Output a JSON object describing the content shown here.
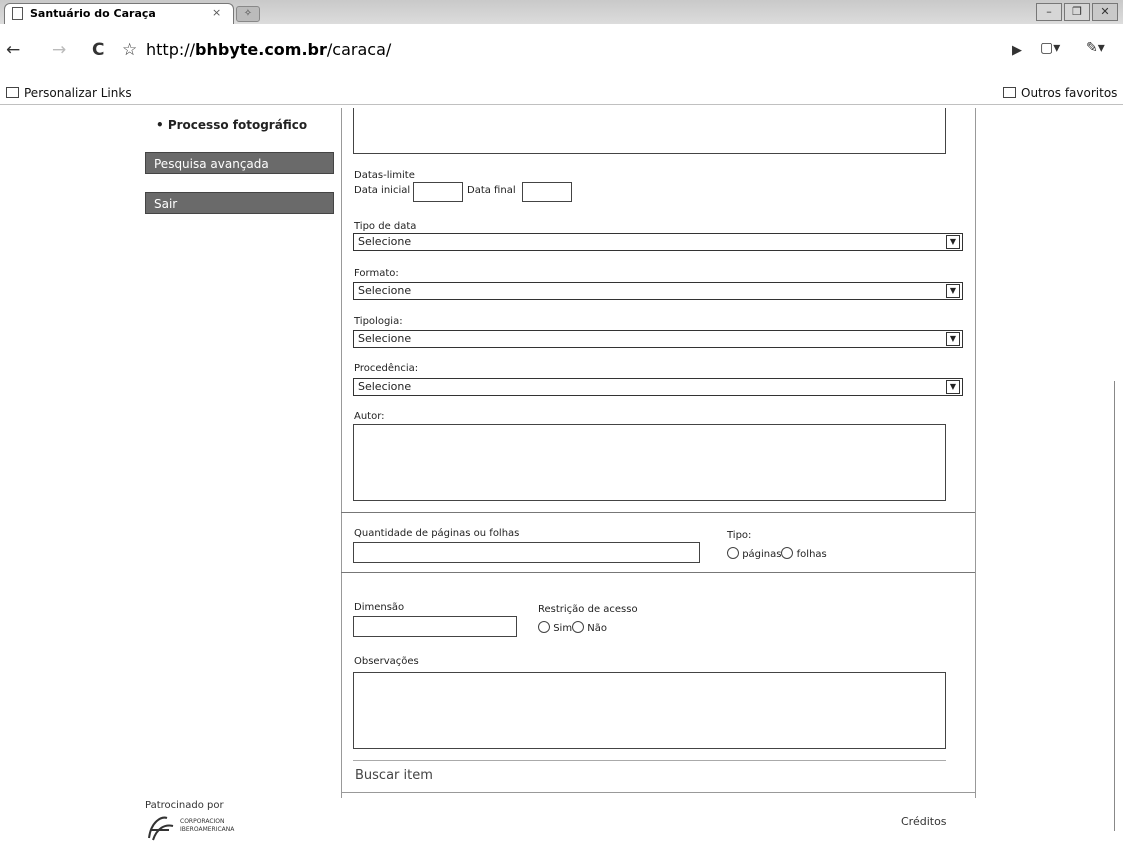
{
  "browser": {
    "tab_title": "Santuário do Caraça",
    "tab_close": "×",
    "new_tab": "✧",
    "url_prefix": "http://",
    "url_host": "bhbyte.com.br",
    "url_path": "/caraca/",
    "bookmark_left": "Personalizar Links",
    "bookmark_right": "Outros favoritos",
    "win_min": "–",
    "win_max": "❐",
    "win_close": "✕"
  },
  "sidebar": {
    "menu_item": "• Processo fotográfico",
    "advanced_search": "Pesquisa avançada",
    "exit": "Sair"
  },
  "form": {
    "date_limit_label": "Datas-limite",
    "start_date_label": "Data inicial",
    "start_date_value": "",
    "end_date_label": "Data final",
    "end_date_value": "",
    "date_type_label": "Tipo de data",
    "date_type_value": "Selecione",
    "format_label": "Formato:",
    "format_value": "Selecione",
    "typology_label": "Tipologia:",
    "typology_value": "Selecione",
    "provenance_label": "Procedência:",
    "provenance_value": "Selecione",
    "author_label": "Autor:",
    "author_value": "",
    "pages_label": "Quantidade de páginas ou folhas",
    "pages_value": "",
    "type_label": "Tipo:",
    "type_opt1": "páginas",
    "type_opt2": "folhas",
    "dimension_label": "Dimensão",
    "dimension_value": "",
    "restriction_label": "Restrição de acesso",
    "restriction_yes": "Sim",
    "restriction_no": "Não",
    "notes_label": "Observações",
    "notes_value": "",
    "search_button": "Buscar item"
  },
  "footer": {
    "sponsored_by": "Patrocinado por",
    "sponsor_name": "CORPORACION IBEROAMERICANA",
    "credits": "Créditos"
  }
}
